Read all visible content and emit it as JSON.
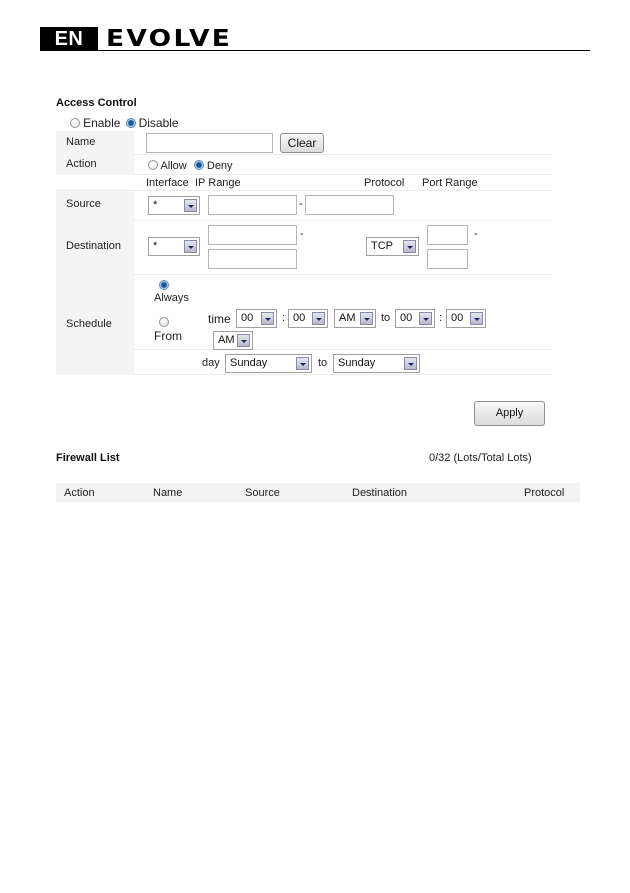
{
  "header": {
    "lang": "EN",
    "brand": "EVOLVE"
  },
  "access_control": {
    "title": "Access Control",
    "enable_label": "Enable",
    "disable_label": "Disable",
    "selected": "Disable",
    "name_label": "Name",
    "name_value": "",
    "clear_label": "Clear",
    "action_label": "Action",
    "allow_label": "Allow",
    "deny_label": "Deny",
    "action_selected": "Deny",
    "col_interface": "Interface",
    "col_ip_range": "IP Range",
    "col_protocol": "Protocol",
    "col_port_range": "Port Range",
    "source_label": "Source",
    "source_interface": "*",
    "source_ip_from": "",
    "source_ip_to": "",
    "range_dash": "-",
    "destination_label": "Destination",
    "destination_interface": "*",
    "destination_ip_from": "",
    "destination_ip_to": "",
    "protocol": "TCP",
    "port_from": "",
    "port_to": "",
    "schedule_label": "Schedule",
    "always_label": "Always",
    "from_label": "From",
    "schedule_selected": "Always",
    "time_label": "time",
    "colon": ":",
    "to_label": "to",
    "start_hour": "00",
    "start_minute": "00",
    "start_ampm": "AM",
    "end_hour": "00",
    "end_minute": "00",
    "end_ampm": "AM",
    "day_label": "day",
    "day_from": "Sunday",
    "day_to": "Sunday",
    "apply_label": "Apply"
  },
  "firewall_list": {
    "title": "Firewall List",
    "count": "0/32 (Lots/Total Lots)",
    "columns": [
      "Action",
      "Name",
      "Source",
      "Destination",
      "Protocol"
    ]
  }
}
